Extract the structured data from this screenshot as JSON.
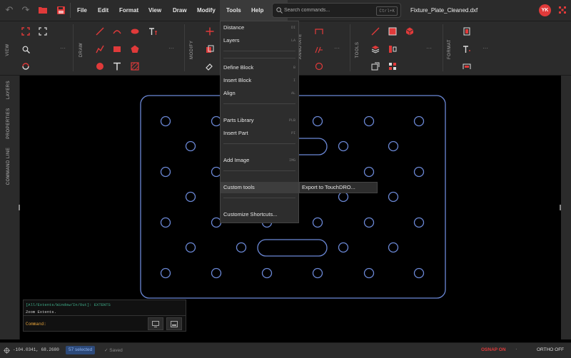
{
  "menubar": {
    "items": [
      "File",
      "Edit",
      "Format",
      "View",
      "Draw",
      "Modify",
      "Tools",
      "Help"
    ],
    "active": "Tools"
  },
  "search": {
    "placeholder": "Search commands...",
    "shortcut": "Ctrl+K"
  },
  "file_name": "Fixture_Plate_Cleaned.dxf",
  "user_initials": "YK",
  "ribbon_groups": {
    "view": "VIEW",
    "draw": "DRAW",
    "modify": "MODIFY",
    "annotate": "ANNOTATE",
    "tools": "TOOLS",
    "format": "FORMAT"
  },
  "left_panel": {
    "layers": "LAYERS",
    "properties": "PROPERTIES",
    "command_line": "COMMAND LINE"
  },
  "tools_menu": {
    "items": [
      {
        "label": "Distance",
        "shortcut": "DI"
      },
      {
        "label": "Layers",
        "shortcut": "LA"
      },
      {
        "label": "Define Block",
        "shortcut": "B"
      },
      {
        "label": "Insert Block",
        "shortcut": "I"
      },
      {
        "label": "Align",
        "shortcut": "AL"
      },
      {
        "label": "Parts Library",
        "shortcut": "PLB"
      },
      {
        "label": "Insert Part",
        "shortcut": "PI"
      },
      {
        "label": "Add Image",
        "shortcut": "IMG"
      },
      {
        "label": "Custom tools",
        "shortcut": ""
      },
      {
        "label": "Customize Shortcuts...",
        "shortcut": ""
      }
    ],
    "submenu_item": "Export to TouchDRO..."
  },
  "command_panel": {
    "options_line": "[All/Extents/Window/In/Out]: EXTENTS",
    "history": "Zoom Extents.",
    "prompt": "Command:"
  },
  "status": {
    "coords": "-104.0341, 68.2680",
    "selected": "57 selected",
    "saved": "Saved",
    "osnap": "OSNAP ON",
    "ortho": "ORTHO OFF"
  },
  "colors": {
    "accent": "#e03a3a",
    "toolbar_bg": "#2b2b2b",
    "geometry": "#6b88d6",
    "selected_badge": "#2d4a7a"
  }
}
